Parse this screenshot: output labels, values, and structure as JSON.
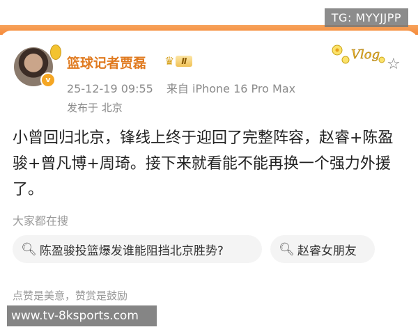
{
  "watermarks": {
    "top_right": "TG: MYYJJPP",
    "bottom_left": "www.tv-8ksports.com"
  },
  "post": {
    "author": "篮球记者贾磊",
    "level_label": "Ⅱ",
    "date": "25-12-19 09:55",
    "source": "来自 iPhone 16 Pro Max",
    "location": "发布于 北京",
    "body": "小曾回归北京，锋线上终于迎回了完整阵容，赵睿+陈盈骏+曾凡博+周琦。接下来就看能不能再换一个强力外援了。",
    "sticker_text": "Vlog"
  },
  "search": {
    "header": "大家都在搜",
    "chips": [
      "陈盈骏投篮爆发谁能阻挡北京胜势?",
      "赵睿女朋友"
    ]
  },
  "footer": {
    "encourage": "点赞是美意，赞赏是鼓励"
  },
  "colors": {
    "accent_orange": "#e07a1f",
    "top_strip": "#f58a3a"
  }
}
